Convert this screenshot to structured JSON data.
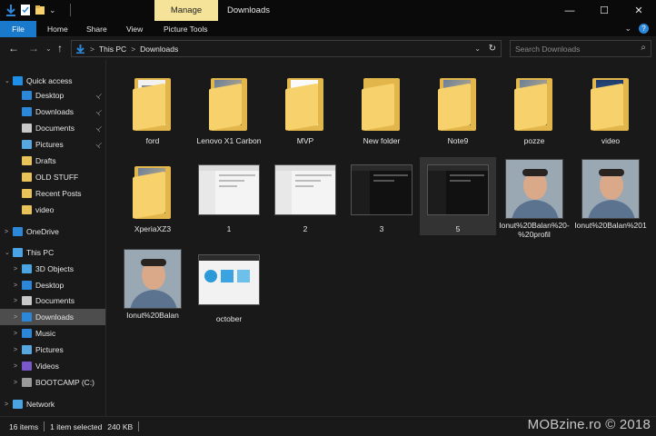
{
  "window": {
    "manage_tab": "Manage",
    "title": "Downloads",
    "minimize": "—",
    "maximize": "☐",
    "close": "✕"
  },
  "ribbon": {
    "tabs": [
      "File",
      "Home",
      "Share",
      "View",
      "Picture Tools"
    ],
    "expand_icon": "⌄",
    "help_icon": "?"
  },
  "address": {
    "back": "←",
    "forward": "→",
    "dropdown": "⌄",
    "up": "↑",
    "crumbs": [
      "This PC",
      "Downloads"
    ],
    "separator": ">",
    "search_placeholder": "Search Downloads"
  },
  "nav": {
    "items": [
      {
        "label": "Quick access",
        "icon": "star-icon",
        "color": "#1e8ee6",
        "chevron": "⌄",
        "pinned": false
      },
      {
        "label": "Desktop",
        "icon": "desktop-icon",
        "color": "#2c87d8",
        "chevron": "",
        "pinned": true
      },
      {
        "label": "Downloads",
        "icon": "download-icon",
        "color": "#2c87d8",
        "chevron": "",
        "pinned": true
      },
      {
        "label": "Documents",
        "icon": "document-icon",
        "color": "#c9c9c9",
        "chevron": "",
        "pinned": true
      },
      {
        "label": "Pictures",
        "icon": "pictures-icon",
        "color": "#56a8de",
        "chevron": "",
        "pinned": true
      },
      {
        "label": "Drafts",
        "icon": "folder-icon",
        "color": "#e9c25a",
        "chevron": "",
        "pinned": false
      },
      {
        "label": "OLD STUFF",
        "icon": "folder-icon",
        "color": "#e9c25a",
        "chevron": "",
        "pinned": false
      },
      {
        "label": "Recent Posts",
        "icon": "folder-icon",
        "color": "#e9c25a",
        "chevron": "",
        "pinned": false
      },
      {
        "label": "video",
        "icon": "folder-icon",
        "color": "#e9c25a",
        "chevron": "",
        "pinned": false
      },
      {
        "label": "OneDrive",
        "icon": "cloud-icon",
        "color": "#2c87d8",
        "chevron": ">",
        "pinned": false
      },
      {
        "label": "This PC",
        "icon": "computer-icon",
        "color": "#4aa3e2",
        "chevron": "⌄",
        "pinned": false
      },
      {
        "label": "3D Objects",
        "icon": "cube-icon",
        "color": "#4aa3e2",
        "chevron": ">",
        "pinned": false
      },
      {
        "label": "Desktop",
        "icon": "desktop-icon",
        "color": "#2c87d8",
        "chevron": ">",
        "pinned": false
      },
      {
        "label": "Documents",
        "icon": "document-icon",
        "color": "#c9c9c9",
        "chevron": ">",
        "pinned": false
      },
      {
        "label": "Downloads",
        "icon": "download-icon",
        "color": "#2c87d8",
        "chevron": ">",
        "pinned": false,
        "selected": true
      },
      {
        "label": "Music",
        "icon": "music-icon",
        "color": "#2c87d8",
        "chevron": ">",
        "pinned": false
      },
      {
        "label": "Pictures",
        "icon": "pictures-icon",
        "color": "#56a8de",
        "chevron": ">",
        "pinned": false
      },
      {
        "label": "Videos",
        "icon": "video-icon",
        "color": "#7a58c9",
        "chevron": ">",
        "pinned": false
      },
      {
        "label": "BOOTCAMP (C:)",
        "icon": "drive-icon",
        "color": "#9a9a9a",
        "chevron": ">",
        "pinned": false
      },
      {
        "label": "Network",
        "icon": "network-icon",
        "color": "#4aa3e2",
        "chevron": ">",
        "pinned": false
      }
    ],
    "pin_glyph": "📌"
  },
  "files": [
    {
      "name": "ford",
      "kind": "folder",
      "preview": "paper"
    },
    {
      "name": "Lenovo X1 Carbon",
      "kind": "folder",
      "preview": "photo"
    },
    {
      "name": "MVP",
      "kind": "folder",
      "preview": "pdf"
    },
    {
      "name": "New folder",
      "kind": "folder",
      "preview": "empty"
    },
    {
      "name": "Note9",
      "kind": "folder",
      "preview": "photo"
    },
    {
      "name": "pozze",
      "kind": "folder",
      "preview": "photo"
    },
    {
      "name": "video",
      "kind": "folder",
      "preview": "screen"
    },
    {
      "name": "XperiaXZ3",
      "kind": "folder",
      "preview": "photo"
    },
    {
      "name": "1",
      "kind": "screenshot",
      "theme": "light"
    },
    {
      "name": "2",
      "kind": "screenshot",
      "theme": "light"
    },
    {
      "name": "3",
      "kind": "screenshot",
      "theme": "dark"
    },
    {
      "name": "5",
      "kind": "screenshot",
      "theme": "dark",
      "selected": true
    },
    {
      "name": "Ionut%20Balan%20-%20profil",
      "kind": "photo"
    },
    {
      "name": "Ionut%20Balan%201",
      "kind": "photo"
    },
    {
      "name": "Ionut%20Balan",
      "kind": "photo"
    },
    {
      "name": "october",
      "kind": "screenshot",
      "theme": "light-blue"
    }
  ],
  "status": {
    "count": "16 items",
    "selected": "1 item selected",
    "size": "240 KB"
  },
  "watermark": "MOBzine.ro © 2018"
}
